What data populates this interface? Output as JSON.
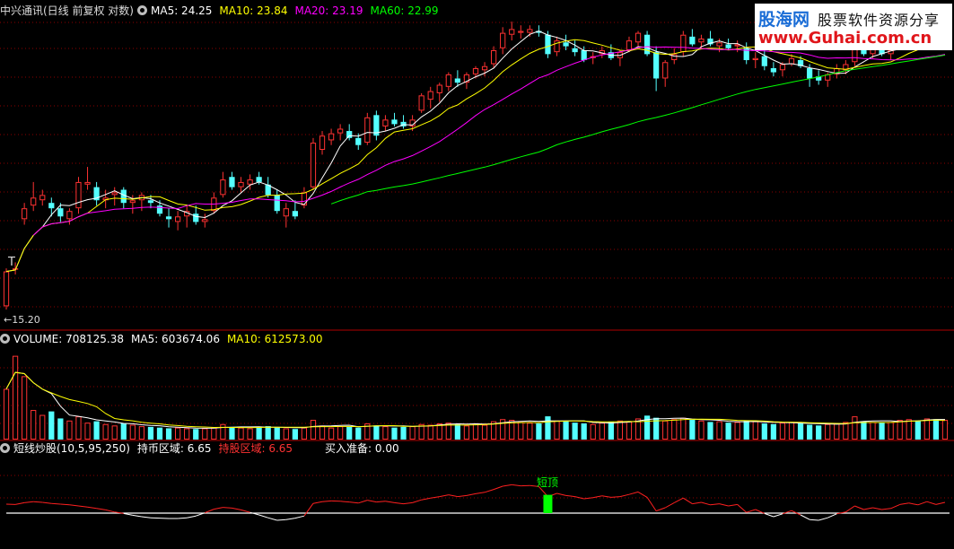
{
  "main_header": {
    "title": "中兴通讯(日线 前复权 对数)",
    "ma5_label": "MA5: 24.25",
    "ma10_label": "MA10: 23.84",
    "ma20_label": "MA20: 23.19",
    "ma60_label": "MA60: 22.99"
  },
  "volume_header": {
    "title": "VOLUME: 708125.38",
    "ma5_label": "MA5: 603674.06",
    "ma10_label": "MA10: 612573.00"
  },
  "indicator_header": {
    "title": "短线炒股(10,5,95,250)",
    "hold_coin_label": "持币区域: 6.65",
    "hold_stock_label": "持股区域: 6.65",
    "buy_ready_label": "买入准备: 0.00"
  },
  "annotations": {
    "low_price": "15.20",
    "marker_t": "T",
    "short_top": "短顶"
  },
  "watermark": {
    "brand": "股海网",
    "slogan": "股票软件资源分享",
    "url": "www.Guhai.com.cn"
  },
  "colors": {
    "up": "#ff3232",
    "down": "#54ffff",
    "ma5": "#ffffff",
    "ma10": "#ffff00",
    "ma20": "#ff00ff",
    "ma60": "#00ff00",
    "indicator_line": "#ff2020",
    "indicator_low": "#ffffff",
    "signal_bar": "#00ff00",
    "grid": "#8b0000"
  },
  "chart_data": [
    {
      "type": "candlestick",
      "title": "中兴通讯(日线 前复权 对数)",
      "scale": "log",
      "ylim": [
        14.7,
        27.0
      ],
      "ohlc": [
        [
          15.2,
          16.4,
          15.1,
          16.3
        ],
        [
          16.4,
          16.6,
          16.2,
          16.4
        ],
        [
          18.1,
          18.7,
          17.9,
          18.5
        ],
        [
          18.6,
          19.5,
          18.4,
          18.9
        ],
        [
          18.8,
          19.2,
          18.6,
          19.0
        ],
        [
          18.7,
          18.9,
          18.2,
          18.5
        ],
        [
          18.5,
          18.7,
          18.0,
          18.2
        ],
        [
          18.1,
          18.5,
          17.9,
          18.4
        ],
        [
          18.5,
          19.7,
          18.3,
          19.5
        ],
        [
          19.4,
          20.1,
          19.2,
          19.5
        ],
        [
          19.3,
          19.5,
          18.6,
          18.8
        ],
        [
          18.8,
          19.2,
          18.5,
          18.9
        ],
        [
          19.0,
          19.3,
          18.6,
          19.1
        ],
        [
          19.2,
          19.3,
          18.5,
          18.7
        ],
        [
          18.7,
          19.0,
          18.3,
          18.8
        ],
        [
          18.8,
          19.1,
          18.4,
          19.0
        ],
        [
          18.8,
          19.0,
          18.5,
          18.7
        ],
        [
          18.6,
          18.8,
          18.2,
          18.3
        ],
        [
          18.2,
          18.5,
          17.8,
          18.1
        ],
        [
          18.0,
          18.4,
          17.7,
          18.2
        ],
        [
          18.2,
          18.6,
          17.8,
          18.4
        ],
        [
          18.3,
          18.6,
          17.9,
          18.0
        ],
        [
          18.0,
          18.3,
          17.8,
          18.1
        ],
        [
          18.4,
          19.1,
          18.3,
          18.9
        ],
        [
          19.0,
          19.9,
          18.9,
          19.6
        ],
        [
          19.7,
          19.9,
          19.2,
          19.3
        ],
        [
          19.3,
          19.7,
          19.1,
          19.5
        ],
        [
          19.4,
          19.8,
          19.2,
          19.6
        ],
        [
          19.7,
          19.9,
          19.4,
          19.5
        ],
        [
          19.4,
          19.7,
          18.9,
          19.0
        ],
        [
          19.0,
          19.2,
          18.3,
          18.4
        ],
        [
          18.2,
          18.7,
          17.8,
          18.5
        ],
        [
          18.4,
          18.8,
          18.1,
          18.2
        ],
        [
          18.6,
          19.3,
          18.5,
          19.1
        ],
        [
          19.3,
          21.3,
          19.2,
          21.1
        ],
        [
          20.8,
          21.6,
          20.6,
          21.4
        ],
        [
          21.2,
          21.7,
          21.0,
          21.5
        ],
        [
          21.5,
          21.9,
          21.2,
          21.7
        ],
        [
          21.6,
          21.9,
          21.2,
          21.3
        ],
        [
          21.3,
          21.5,
          20.8,
          21.0
        ],
        [
          21.1,
          22.4,
          21.0,
          22.2
        ],
        [
          22.3,
          22.5,
          21.2,
          21.4
        ],
        [
          21.8,
          22.3,
          21.6,
          22.1
        ],
        [
          22.1,
          22.4,
          21.8,
          21.9
        ],
        [
          22.0,
          22.3,
          21.7,
          21.8
        ],
        [
          21.8,
          22.3,
          21.6,
          22.1
        ],
        [
          22.5,
          23.3,
          22.4,
          23.2
        ],
        [
          23.0,
          23.6,
          22.6,
          23.4
        ],
        [
          23.3,
          23.8,
          22.9,
          23.7
        ],
        [
          23.6,
          24.3,
          23.4,
          24.2
        ],
        [
          24.0,
          24.4,
          23.6,
          23.8
        ],
        [
          23.8,
          24.3,
          23.5,
          24.2
        ],
        [
          24.2,
          24.6,
          24.0,
          24.5
        ],
        [
          24.4,
          24.8,
          24.1,
          24.6
        ],
        [
          24.7,
          25.6,
          24.5,
          25.4
        ],
        [
          25.5,
          26.6,
          25.2,
          26.3
        ],
        [
          26.2,
          26.9,
          25.9,
          26.5
        ],
        [
          26.3,
          26.7,
          26.0,
          26.4
        ],
        [
          26.3,
          26.7,
          26.1,
          26.5
        ],
        [
          26.4,
          26.7,
          26.1,
          26.3
        ],
        [
          26.2,
          26.4,
          25.0,
          25.2
        ],
        [
          25.3,
          26.1,
          25.1,
          25.9
        ],
        [
          25.8,
          26.2,
          25.4,
          25.6
        ],
        [
          25.5,
          25.9,
          25.1,
          25.3
        ],
        [
          25.4,
          25.6,
          24.8,
          24.9
        ],
        [
          25.0,
          25.3,
          24.7,
          25.1
        ],
        [
          25.2,
          25.6,
          25.0,
          25.4
        ],
        [
          25.3,
          25.7,
          24.9,
          25.0
        ],
        [
          25.0,
          25.4,
          24.6,
          25.3
        ],
        [
          25.4,
          26.1,
          25.3,
          25.9
        ],
        [
          25.8,
          26.4,
          25.6,
          26.3
        ],
        [
          26.2,
          26.4,
          25.1,
          25.2
        ],
        [
          25.3,
          25.6,
          23.4,
          24.0
        ],
        [
          24.0,
          24.9,
          23.6,
          24.8
        ],
        [
          24.9,
          25.5,
          24.7,
          25.2
        ],
        [
          25.3,
          26.4,
          25.1,
          26.2
        ],
        [
          26.1,
          26.5,
          25.6,
          25.7
        ],
        [
          25.8,
          26.2,
          25.5,
          26.0
        ],
        [
          26.0,
          26.4,
          25.6,
          25.7
        ],
        [
          25.6,
          26.0,
          25.3,
          25.8
        ],
        [
          25.7,
          26.0,
          25.4,
          25.5
        ],
        [
          25.6,
          25.9,
          25.3,
          25.7
        ],
        [
          25.5,
          25.8,
          24.7,
          24.9
        ],
        [
          24.9,
          25.3,
          24.5,
          25.0
        ],
        [
          25.1,
          25.4,
          24.4,
          24.6
        ],
        [
          24.5,
          24.8,
          24.1,
          24.3
        ],
        [
          24.4,
          24.8,
          24.1,
          24.7
        ],
        [
          24.7,
          25.2,
          24.6,
          25.0
        ],
        [
          24.9,
          25.1,
          24.5,
          24.6
        ],
        [
          24.5,
          24.7,
          23.6,
          24.0
        ],
        [
          24.1,
          24.4,
          23.7,
          23.9
        ],
        [
          23.9,
          24.3,
          23.6,
          24.2
        ],
        [
          24.2,
          24.7,
          24.0,
          24.5
        ],
        [
          24.4,
          24.9,
          24.2,
          24.7
        ],
        [
          24.8,
          25.6,
          24.6,
          25.5
        ],
        [
          25.4,
          25.7,
          25.1,
          25.2
        ],
        [
          25.2,
          25.8,
          25.0,
          25.5
        ],
        [
          25.4,
          25.7,
          25.1,
          25.2
        ],
        [
          25.2,
          25.6,
          24.9,
          25.4
        ],
        [
          25.5,
          26.2,
          25.4,
          26.0
        ],
        [
          26.0,
          26.4,
          25.7,
          26.2
        ],
        [
          26.2,
          26.5,
          25.9,
          26.0
        ],
        [
          26.1,
          26.6,
          25.9,
          26.4
        ],
        [
          26.3,
          26.7,
          26.0,
          26.1
        ],
        [
          26.2,
          26.6,
          25.9,
          26.4
        ]
      ],
      "ma": [
        {
          "name": "MA5",
          "value": 24.25
        },
        {
          "name": "MA10",
          "value": 23.84
        },
        {
          "name": "MA20",
          "value": 23.19
        },
        {
          "name": "MA60",
          "value": 22.99
        }
      ],
      "annotations": [
        "15.20",
        "T"
      ]
    },
    {
      "type": "bar",
      "title": "VOLUME: 708125.38",
      "ylim": [
        0,
        1300000
      ],
      "values": [
        720000,
        1190000,
        900000,
        420000,
        350000,
        400000,
        300000,
        270000,
        330000,
        240000,
        260000,
        220000,
        200000,
        230000,
        210000,
        190000,
        180000,
        170000,
        160000,
        170000,
        160000,
        150000,
        160000,
        170000,
        220000,
        180000,
        170000,
        160000,
        180000,
        190000,
        170000,
        160000,
        150000,
        170000,
        280000,
        200000,
        170000,
        190000,
        180000,
        170000,
        230000,
        200000,
        190000,
        170000,
        180000,
        190000,
        220000,
        210000,
        230000,
        240000,
        220000,
        200000,
        230000,
        210000,
        260000,
        290000,
        280000,
        250000,
        240000,
        230000,
        330000,
        270000,
        260000,
        240000,
        230000,
        220000,
        240000,
        250000,
        270000,
        260000,
        300000,
        340000,
        310000,
        270000,
        290000,
        310000,
        280000,
        270000,
        250000,
        260000,
        240000,
        250000,
        270000,
        260000,
        230000,
        220000,
        240000,
        250000,
        230000,
        210000,
        200000,
        220000,
        230000,
        250000,
        330000,
        260000,
        250000,
        240000,
        250000,
        280000,
        290000,
        270000,
        300000,
        290000,
        280000
      ],
      "ma": [
        {
          "name": "MA5",
          "value": 603674.06
        },
        {
          "name": "MA10",
          "value": 612573.0
        }
      ]
    },
    {
      "type": "line",
      "title": "短线炒股(10,5,95,250)",
      "ylim": [
        0,
        100
      ],
      "values": [
        45,
        44,
        49,
        52,
        50,
        47,
        45,
        43,
        40,
        37,
        33,
        29,
        23,
        19,
        14,
        10,
        7,
        6,
        5,
        5,
        7,
        12,
        21,
        31,
        36,
        34,
        29,
        22,
        15,
        7,
        0,
        2,
        6,
        12,
        47,
        52,
        54,
        53,
        51,
        48,
        56,
        51,
        53,
        49,
        46,
        49,
        57,
        62,
        66,
        71,
        66,
        69,
        74,
        78,
        86,
        95,
        99,
        96,
        97,
        94,
        66,
        75,
        69,
        66,
        60,
        63,
        68,
        64,
        66,
        72,
        79,
        64,
        26,
        35,
        49,
        62,
        46,
        50,
        43,
        46,
        40,
        44,
        22,
        30,
        19,
        10,
        18,
        27,
        15,
        2,
        0,
        7,
        18,
        23,
        40,
        30,
        35,
        30,
        33,
        44,
        48,
        43,
        52,
        44,
        50
      ],
      "threshold": 20,
      "signal_index": 61,
      "annotations": [
        "短顶"
      ]
    }
  ]
}
